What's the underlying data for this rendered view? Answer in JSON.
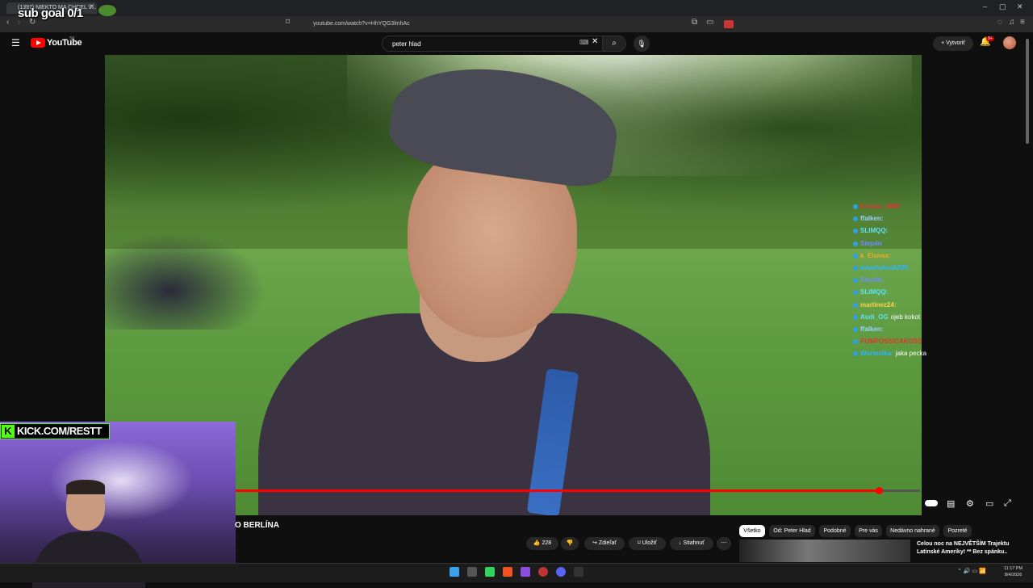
{
  "browser": {
    "tab_title": "(1397) NIEKTO MA CHCEL V...",
    "url": "youtube.com/watch?v=HhYQG3lmhAc"
  },
  "overlay": {
    "sub_goal": "sub goal 0/1",
    "kick": "KICK.COM/RESTT",
    "kick_k": "K"
  },
  "youtube": {
    "logo": "YouTube",
    "region": "SK",
    "search_query": "peter hlad",
    "create_label": "Vytvoriť",
    "notifications_badge": "9+"
  },
  "chat": [
    {
      "user": "Kr1sxx_4680",
      "msg": ""
    },
    {
      "user": "ffalken:",
      "msg": ""
    },
    {
      "user": "SLIMQQ:",
      "msg": ""
    },
    {
      "user": "Step4n",
      "msg": ""
    },
    {
      "user": "k_Elanaa:",
      "msg": ""
    },
    {
      "user": "lukasluksa6339:",
      "msg": ""
    },
    {
      "user": "Step4n:",
      "msg": ""
    },
    {
      "user": "SLIMQQ:",
      "msg": ""
    },
    {
      "user": "martinez24:",
      "msg": ""
    },
    {
      "user": "Audi_OG",
      "msg": "ojeb kokot"
    },
    {
      "user": "ffalken:",
      "msg": ""
    },
    {
      "user": "PUMPOSSICAKOSS",
      "msg": ""
    },
    {
      "user": "Worteslka:",
      "msg": "jaka pecka"
    }
  ],
  "video": {
    "title": "O BERLÍNA",
    "progress": 0.94,
    "likes": "228",
    "share_label": "Zdieľať",
    "save_label": "Uložiť",
    "download_label": "Stiahnuť"
  },
  "chips": [
    "Všetko",
    "Od: Peter Hlad",
    "Podobné",
    "Pre vás",
    "Nedávno nahrané",
    "Pozreté"
  ],
  "recommendation": {
    "title": "Celou noc na NEJVĚTŠÍM Trajektu Latinské Ameriky! ** Bez spánku.."
  },
  "taskbar": {
    "time": "11:17 PM",
    "date": "8/4/2026"
  },
  "icons": {
    "menu": "hamburger-icon",
    "search": "search-icon",
    "mic": "mic-icon",
    "bell": "bell-icon"
  },
  "colors": {
    "accent": "#ff0000",
    "kick": "#53fc18"
  }
}
